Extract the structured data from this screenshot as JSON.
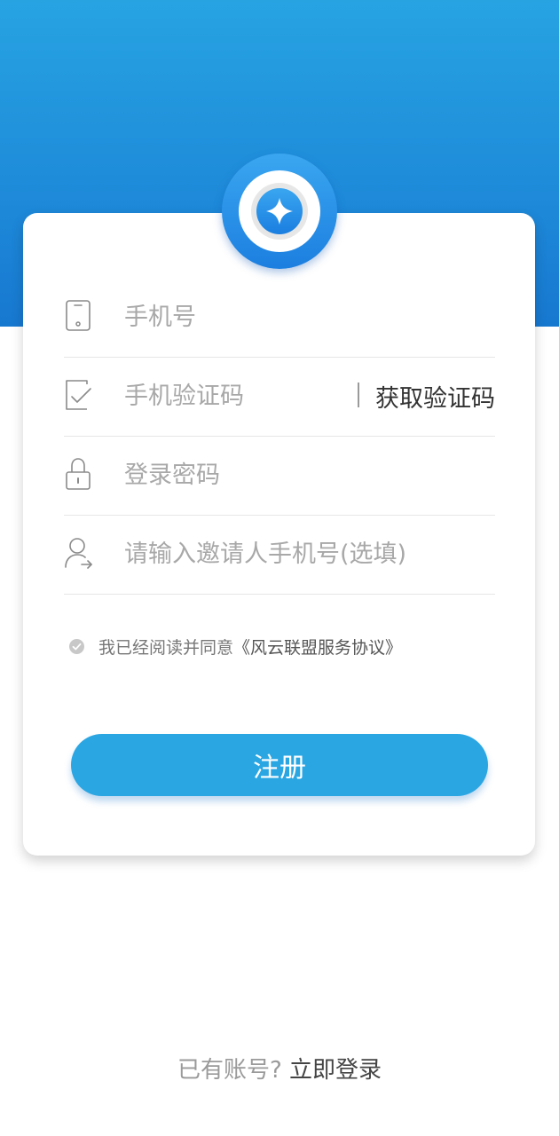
{
  "form": {
    "phone_placeholder": "手机号",
    "code_placeholder": "手机验证码",
    "get_code_label": "获取验证码",
    "password_placeholder": "登录密码",
    "inviter_placeholder": "请输入邀请人手机号(选填)"
  },
  "agreement": {
    "prefix": "我已经阅读并同意",
    "link": "《风云联盟服务协议》"
  },
  "register_label": "注册",
  "footer": {
    "question": "已有账号? ",
    "login_label": "立即登录"
  },
  "colors": {
    "brand": "#27a3e2",
    "button": "#2aa6e3"
  }
}
